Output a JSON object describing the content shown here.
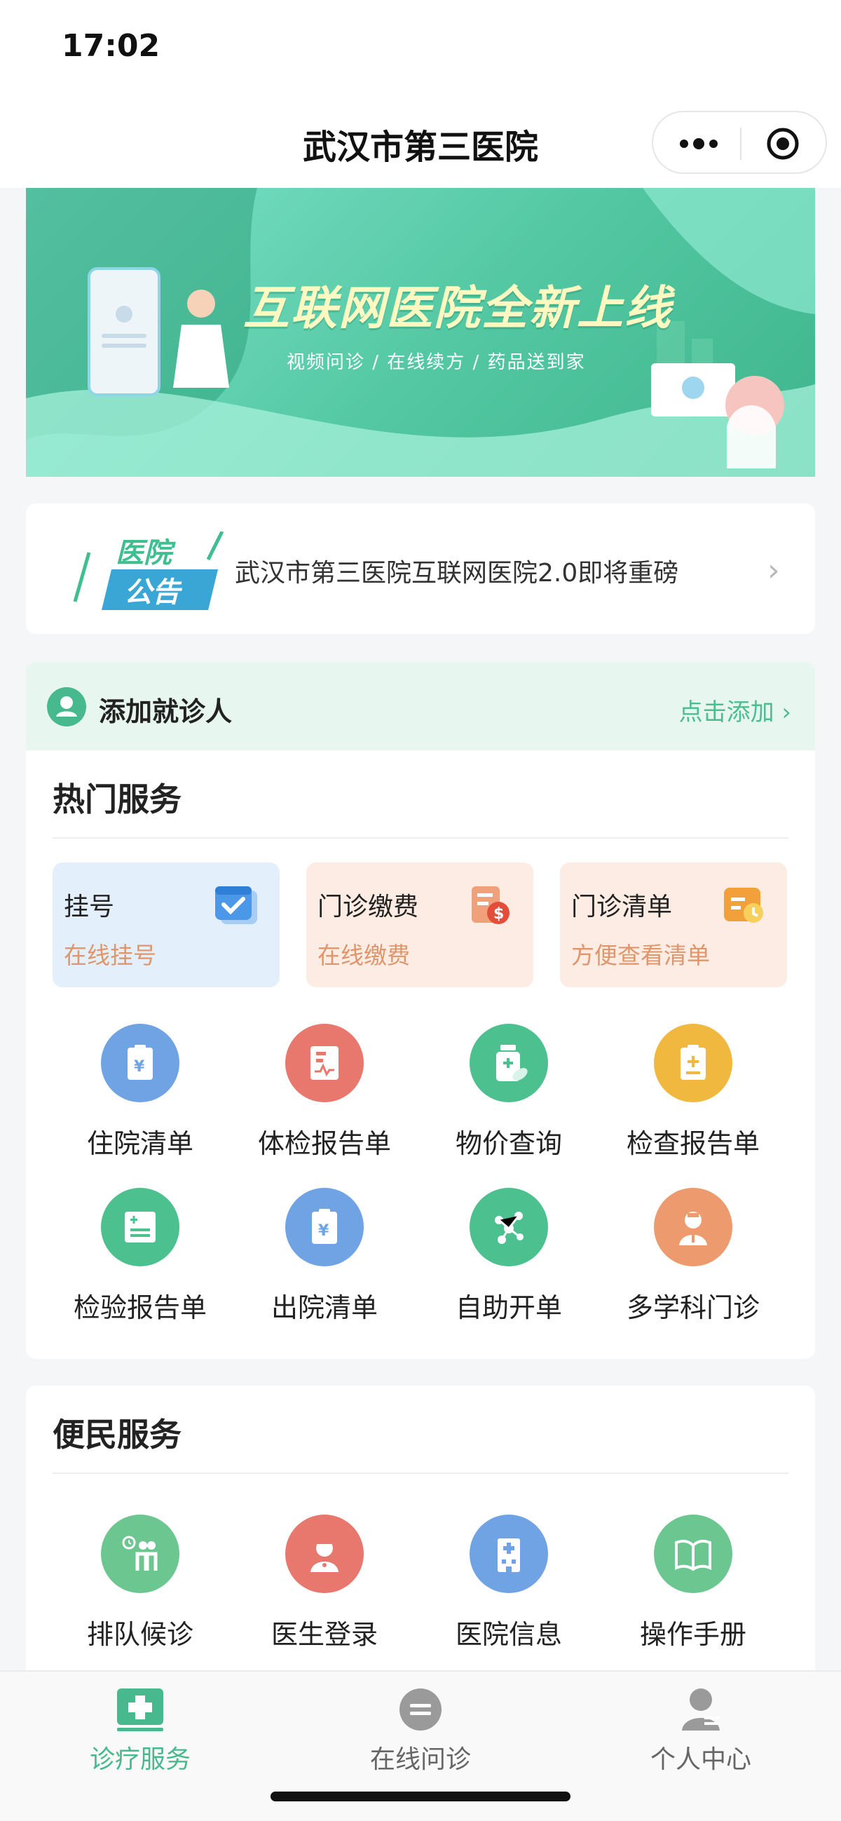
{
  "status_bar": {
    "time": "17:02"
  },
  "navbar": {
    "title": "武汉市第三医院"
  },
  "banner": {
    "title": "互联网医院全新上线",
    "subtitle": "视频问诊 / 在线续方 / 药品送到家"
  },
  "notice": {
    "badge_line1": "医院",
    "badge_line2": "公告",
    "text": "武汉市第三医院互联网医院2.0即将重磅",
    "arrow": "›"
  },
  "add_patient": {
    "label": "添加就诊人",
    "link": "点击添加 ›"
  },
  "hot_services": {
    "title": "热门服务",
    "tiles": [
      {
        "title": "挂号",
        "subtitle": "在线挂号",
        "icon": "calendar-check-icon",
        "bg": "#e4effc",
        "sub_color": "#e0956a"
      },
      {
        "title": "门诊缴费",
        "subtitle": "在线缴费",
        "icon": "bill-payment-icon",
        "bg": "#fcece3",
        "sub_color": "#e0956a"
      },
      {
        "title": "门诊清单",
        "subtitle": "方便查看清单",
        "icon": "list-clock-icon",
        "bg": "#fcece3",
        "sub_color": "#e0956a"
      }
    ],
    "items": [
      {
        "label": "住院清单",
        "icon": "yuan-clipboard-icon",
        "color": "#6fa3e3"
      },
      {
        "label": "体检报告单",
        "icon": "health-report-icon",
        "color": "#e8786e"
      },
      {
        "label": "物价查询",
        "icon": "medicine-bottle-icon",
        "color": "#4cc08e"
      },
      {
        "label": "检查报告单",
        "icon": "exam-clipboard-icon",
        "color": "#f0b83e"
      },
      {
        "label": "检验报告单",
        "icon": "lab-report-icon",
        "color": "#4cc08e"
      },
      {
        "label": "出院清单",
        "icon": "yuan-clipboard-icon",
        "color": "#6fa3e3"
      },
      {
        "label": "自助开单",
        "icon": "network-nodes-icon",
        "color": "#4cc08e"
      },
      {
        "label": "多学科门诊",
        "icon": "doctor-team-icon",
        "color": "#ec9a6e"
      }
    ]
  },
  "convenience_services": {
    "title": "便民服务",
    "items": [
      {
        "label": "排队候诊",
        "icon": "queue-wait-icon",
        "color": "#6cc690"
      },
      {
        "label": "医生登录",
        "icon": "doctor-login-icon",
        "color": "#e8786e"
      },
      {
        "label": "医院信息",
        "icon": "hospital-building-icon",
        "color": "#6fa3e3"
      },
      {
        "label": "操作手册",
        "icon": "open-book-icon",
        "color": "#6cc690"
      }
    ]
  },
  "tabbar": {
    "tabs": [
      {
        "label": "诊疗服务",
        "icon": "medical-kit-icon",
        "active": true
      },
      {
        "label": "在线问诊",
        "icon": "chat-bubble-icon",
        "active": false
      },
      {
        "label": "个人中心",
        "icon": "user-profile-icon",
        "active": false
      }
    ],
    "active_color": "#48b98e",
    "inactive_color": "#666666"
  }
}
